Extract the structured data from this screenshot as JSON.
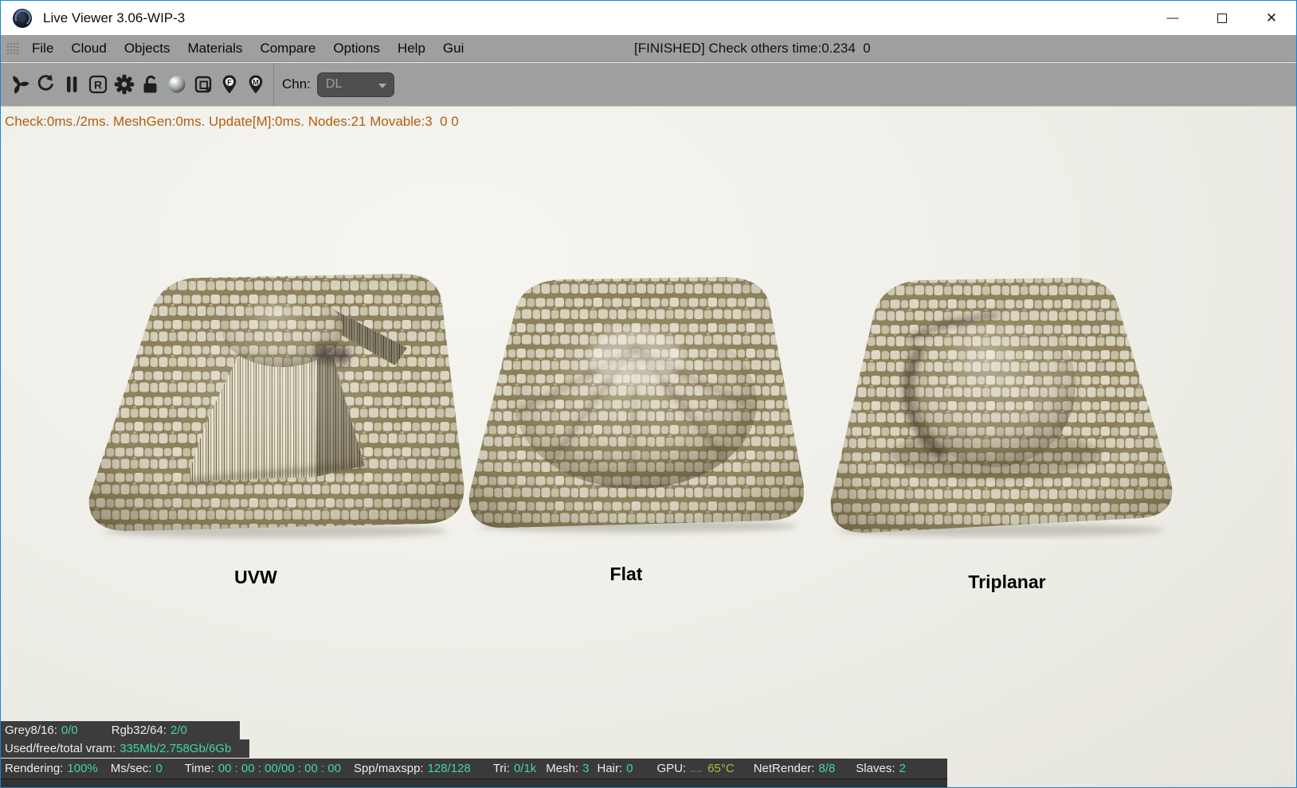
{
  "window": {
    "title": "Live Viewer 3.06-WIP-3",
    "minimize_glyph": "—",
    "close_glyph": "✕"
  },
  "menu": {
    "items": [
      "File",
      "Cloud",
      "Objects",
      "Materials",
      "Compare",
      "Options",
      "Help",
      "Gui"
    ],
    "status": "[FINISHED] Check others time:0.234  0"
  },
  "toolbar": {
    "icons": [
      "render-fan-icon",
      "refresh-icon",
      "pause-icon",
      "restart-letter-icon",
      "settings-gear-icon",
      "lock-icon",
      "material-sphere-icon",
      "render-region-icon",
      "pin-focus-icon",
      "pin-material-icon"
    ],
    "restart_glyph": "R",
    "pin_focus_glyph": "F",
    "pin_material_glyph": "M",
    "chn_label": "Chn:",
    "channel_value": "DL"
  },
  "status_line": "Check:0ms./2ms. MeshGen:0ms. Update[M]:0ms. Nodes:21 Movable:3  0 0",
  "viewport": {
    "panels": [
      {
        "label": "UVW"
      },
      {
        "label": "Flat"
      },
      {
        "label": "Triplanar"
      }
    ]
  },
  "stats": {
    "row1": [
      {
        "label": "Grey8/16:",
        "value": "0/0"
      },
      {
        "label": "Rgb32/64:",
        "value": "2/0"
      }
    ],
    "row2": {
      "label": "Used/free/total vram:",
      "value": "335Mb/2.758Gb/6Gb"
    },
    "bottom": [
      {
        "label": "Rendering:",
        "value": "100%"
      },
      {
        "label": "Ms/sec:",
        "value": "0"
      },
      {
        "label": "Time:",
        "value": "00 : 00 : 00/00 : 00 : 00"
      },
      {
        "label": "Spp/maxspp:",
        "value": "128/128"
      },
      {
        "label": "Tri:",
        "value": "0/1k"
      },
      {
        "label": "Mesh:",
        "value": "3"
      },
      {
        "label": "Hair:",
        "value": "0"
      },
      {
        "label": "GPU:",
        "value": "65°C"
      },
      {
        "label": "NetRender:",
        "value": "8/8"
      },
      {
        "label": "Slaves:",
        "value": "2"
      }
    ]
  },
  "colors": {
    "accent_teal": "#45d5a1",
    "temp_green": "#9fc33f",
    "status_orange": "#b15e10",
    "window_border_blue": "#1385d8",
    "chrome_gray": "#9f9f9f"
  }
}
